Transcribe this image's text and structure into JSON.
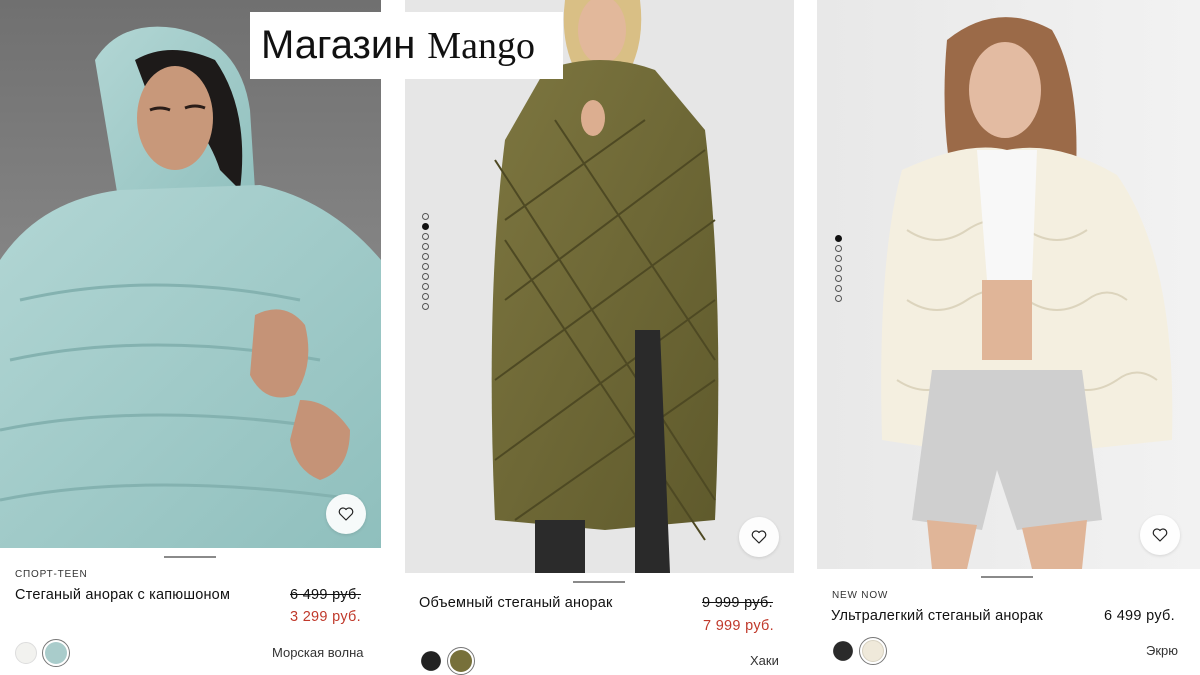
{
  "banner": {
    "title_main": "Магазин",
    "title_brand": "Mango"
  },
  "products": [
    {
      "tag": "СПОРТ-TEEN",
      "name": "Стеганый анорак с капюшоном",
      "old_price": "6 499 руб.",
      "price": "3 299 руб.",
      "color_name": "Морская волна",
      "swatches": [
        "#f2f2ef",
        "#a9cccb"
      ],
      "selected_swatch": 1,
      "image_pages": 0,
      "active_image": 0,
      "icon": "heart-icon"
    },
    {
      "tag": "",
      "name": "Объемный стеганый анорак",
      "old_price": "9 999 руб.",
      "price": "7 999 руб.",
      "color_name": "Хаки",
      "swatches": [
        "#222222",
        "#77703a"
      ],
      "selected_swatch": 1,
      "image_pages": 10,
      "active_image": 1,
      "icon": "heart-icon"
    },
    {
      "tag": "NEW NOW",
      "name": "Ультралегкий стеганый анорак",
      "price": "6 499 руб.",
      "color_name": "Экрю",
      "swatches": [
        "#2a2a2a",
        "#efe9da"
      ],
      "selected_swatch": 1,
      "image_pages": 7,
      "active_image": 0,
      "icon": "heart-icon"
    }
  ],
  "colors": {
    "sale_red": "#c0392b",
    "text": "#111111",
    "muted": "#333333"
  }
}
